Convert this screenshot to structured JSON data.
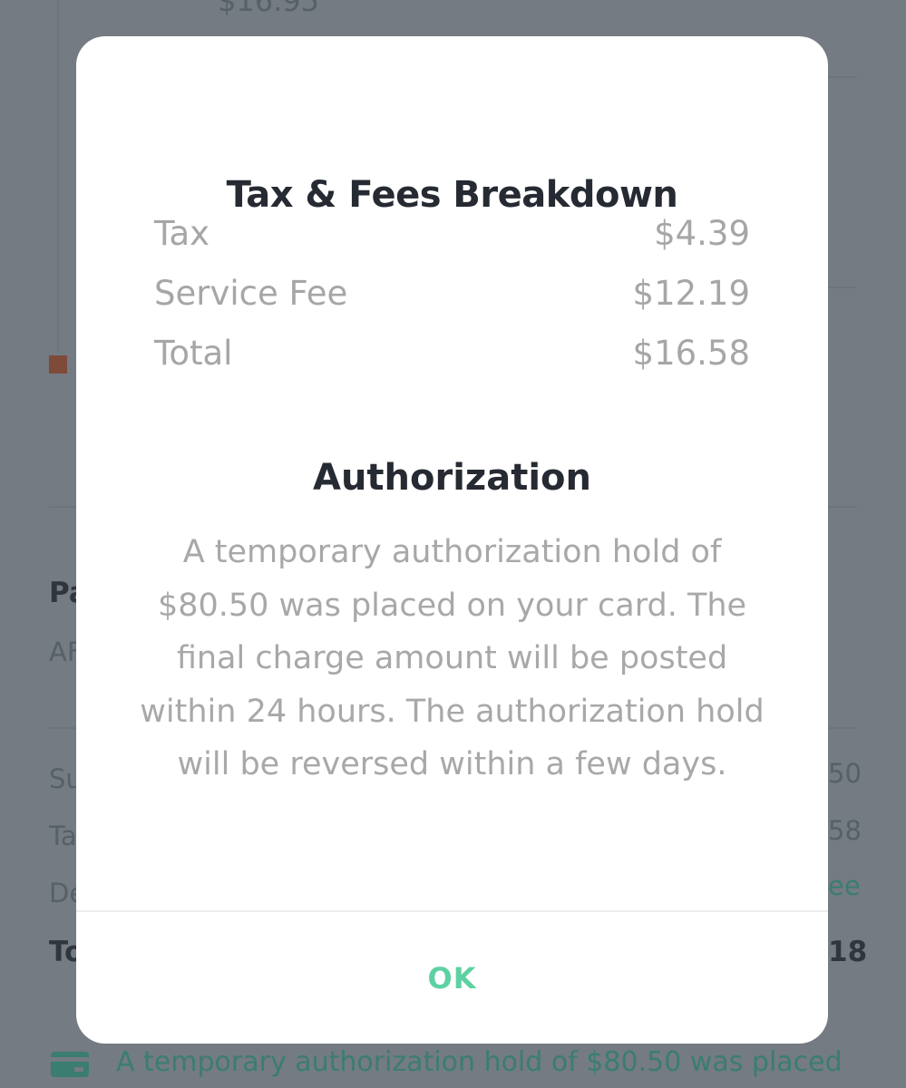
{
  "background": {
    "top_price": "$16.95",
    "payment_heading": "Pa",
    "payment_method": "AF",
    "summary_labels": [
      "Su",
      "Ta",
      "De"
    ],
    "total_label": "To",
    "summary_values": [
      "50",
      "58"
    ],
    "delivery_value": "ee",
    "total_value": "18",
    "footer_note": "A temporary authorization hold of $80.50 was placed",
    "card_icon": "credit-card-icon",
    "accent_color": "#3b7d70"
  },
  "modal": {
    "title": "Tax & Fees Breakdown",
    "fees": [
      {
        "label": "Tax",
        "value": "$4.39"
      },
      {
        "label": "Service Fee",
        "value": "$12.19"
      },
      {
        "label": "Total",
        "value": "$16.58"
      }
    ],
    "auth_title": "Authorization",
    "auth_body": "A temporary authorization hold of $80.50 was placed on your card. The final charge amount will be posted within 24 hours. The authorization hold will be reversed within a few days.",
    "ok_label": "OK",
    "ok_color": "#5ed1a2"
  }
}
